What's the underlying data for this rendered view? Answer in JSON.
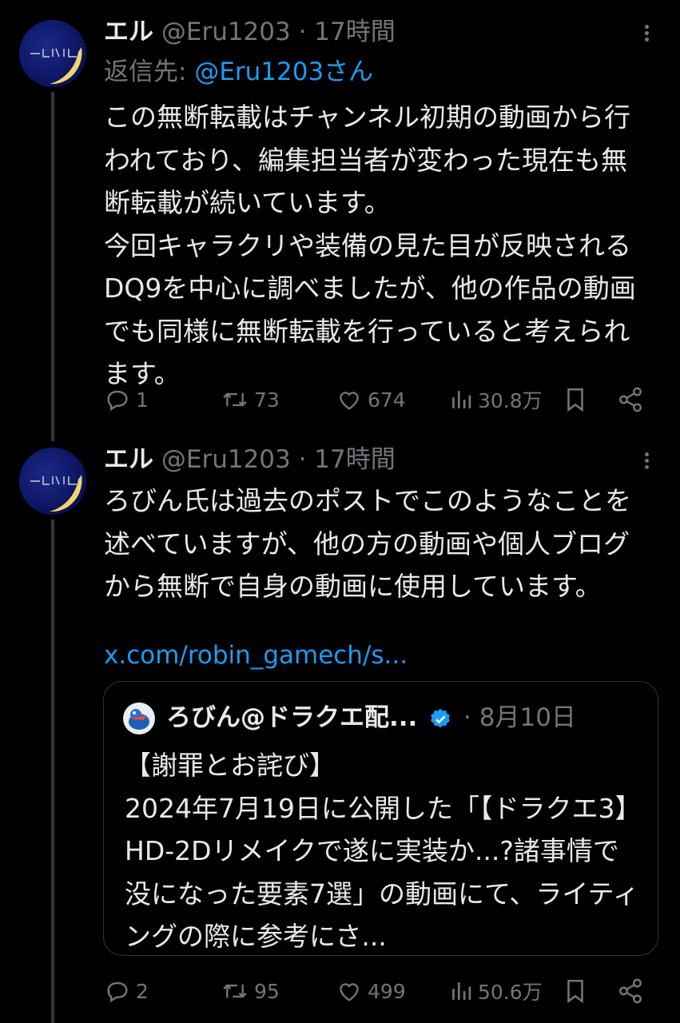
{
  "tweets": [
    {
      "name": "エル",
      "handle": "@Eru1203",
      "separator": " · ",
      "time": "17時間",
      "reply_label": "返信先: ",
      "reply_mention": "@Eru1203さん",
      "text": "この無断転載はチャンネル初期の動画から行われており、編集担当者が変わった現在も無断転載が続いています。\n今回キャラクリや装備の見た目が反映されるDQ9を中心に調べましたが、他の作品の動画でも同様に無断転載を行っていると考えられます。",
      "actions": {
        "replies": "1",
        "reposts": "73",
        "likes": "674",
        "views": "30.8万"
      }
    },
    {
      "name": "エル",
      "handle": "@Eru1203",
      "separator": " · ",
      "time": "17時間",
      "text": "ろびん氏は過去のポストでこのようなことを述べていますが、他の方の動画や個人ブログから無断で自身の動画に使用しています。",
      "link": "x.com/robin_gamech/s...",
      "quote": {
        "name": "ろびん@ドラクエ配...",
        "separator": " · ",
        "date": "8月10日",
        "text": "【謝罪とお詫び】\n2024年7月19日に公開した「【ドラクエ3】HD-2Dリメイクで遂に実装か...?諸事情で没になった要素7選」の動画にて、ライティングの際に参考にさ..."
      },
      "actions": {
        "replies": "2",
        "reposts": "95",
        "likes": "499",
        "views": "50.6万"
      }
    }
  ],
  "colors": {
    "background": "#000000",
    "text": "#e7e9ea",
    "muted": "#71767b",
    "accent": "#1d9bf0",
    "thread_line": "#333639"
  },
  "icons": [
    "more-icon",
    "reply-icon",
    "repost-icon",
    "like-icon",
    "views-icon",
    "bookmark-icon",
    "share-icon",
    "verified-badge-icon"
  ]
}
